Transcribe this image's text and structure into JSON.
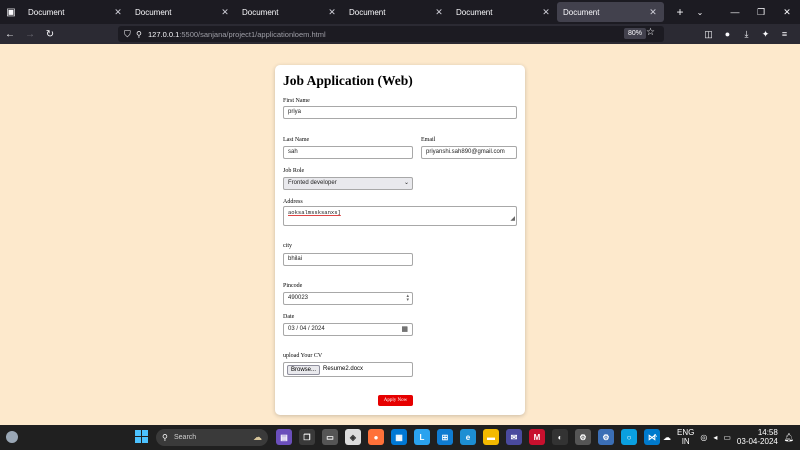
{
  "browser": {
    "tabs": [
      {
        "title": "Document",
        "close": "✕"
      },
      {
        "title": "Document",
        "close": "✕"
      },
      {
        "title": "Document",
        "close": "✕"
      },
      {
        "title": "Document",
        "close": "✕"
      },
      {
        "title": "Document",
        "close": "✕"
      },
      {
        "title": "Document",
        "close": "✕"
      }
    ],
    "active_tab_index": 5,
    "url_host": "127.0.0.1",
    "url_rest": ":5500/sanjana/project1/applicationloem.html",
    "zoom": "80%"
  },
  "form": {
    "title": "Job Application (Web)",
    "first_name_label": "First Name",
    "first_name_value": "priya",
    "last_name_label": "Last Name",
    "last_name_value": "sah",
    "email_label": "Email",
    "email_value": "priyanshi.sah890@gmail.com",
    "job_role_label": "Job Role",
    "job_role_value": "Fronted developer",
    "address_label": "Address",
    "address_value": "aoksalmssksanxs]",
    "city_label": "city",
    "city_value": "bhilai",
    "pincode_label": "Pincode",
    "pincode_value": "490023",
    "date_label": "Date",
    "date_value": "03 / 04 / 2024",
    "cv_label": "upload Your CV",
    "browse_label": "Browse...",
    "file_name": "Resume2.docx",
    "submit_label": "Apply Now",
    "submit_color": "#e60000"
  },
  "taskbar": {
    "search_placeholder": "Search",
    "lang_top": "ENG",
    "lang_bottom": "IN",
    "time": "14:58",
    "date": "03-04-2024"
  },
  "colors": {
    "page_background": "#fde9cc",
    "tabbar": "#1c1b22",
    "navbar": "#2b2a33",
    "taskbar": "#202020"
  }
}
